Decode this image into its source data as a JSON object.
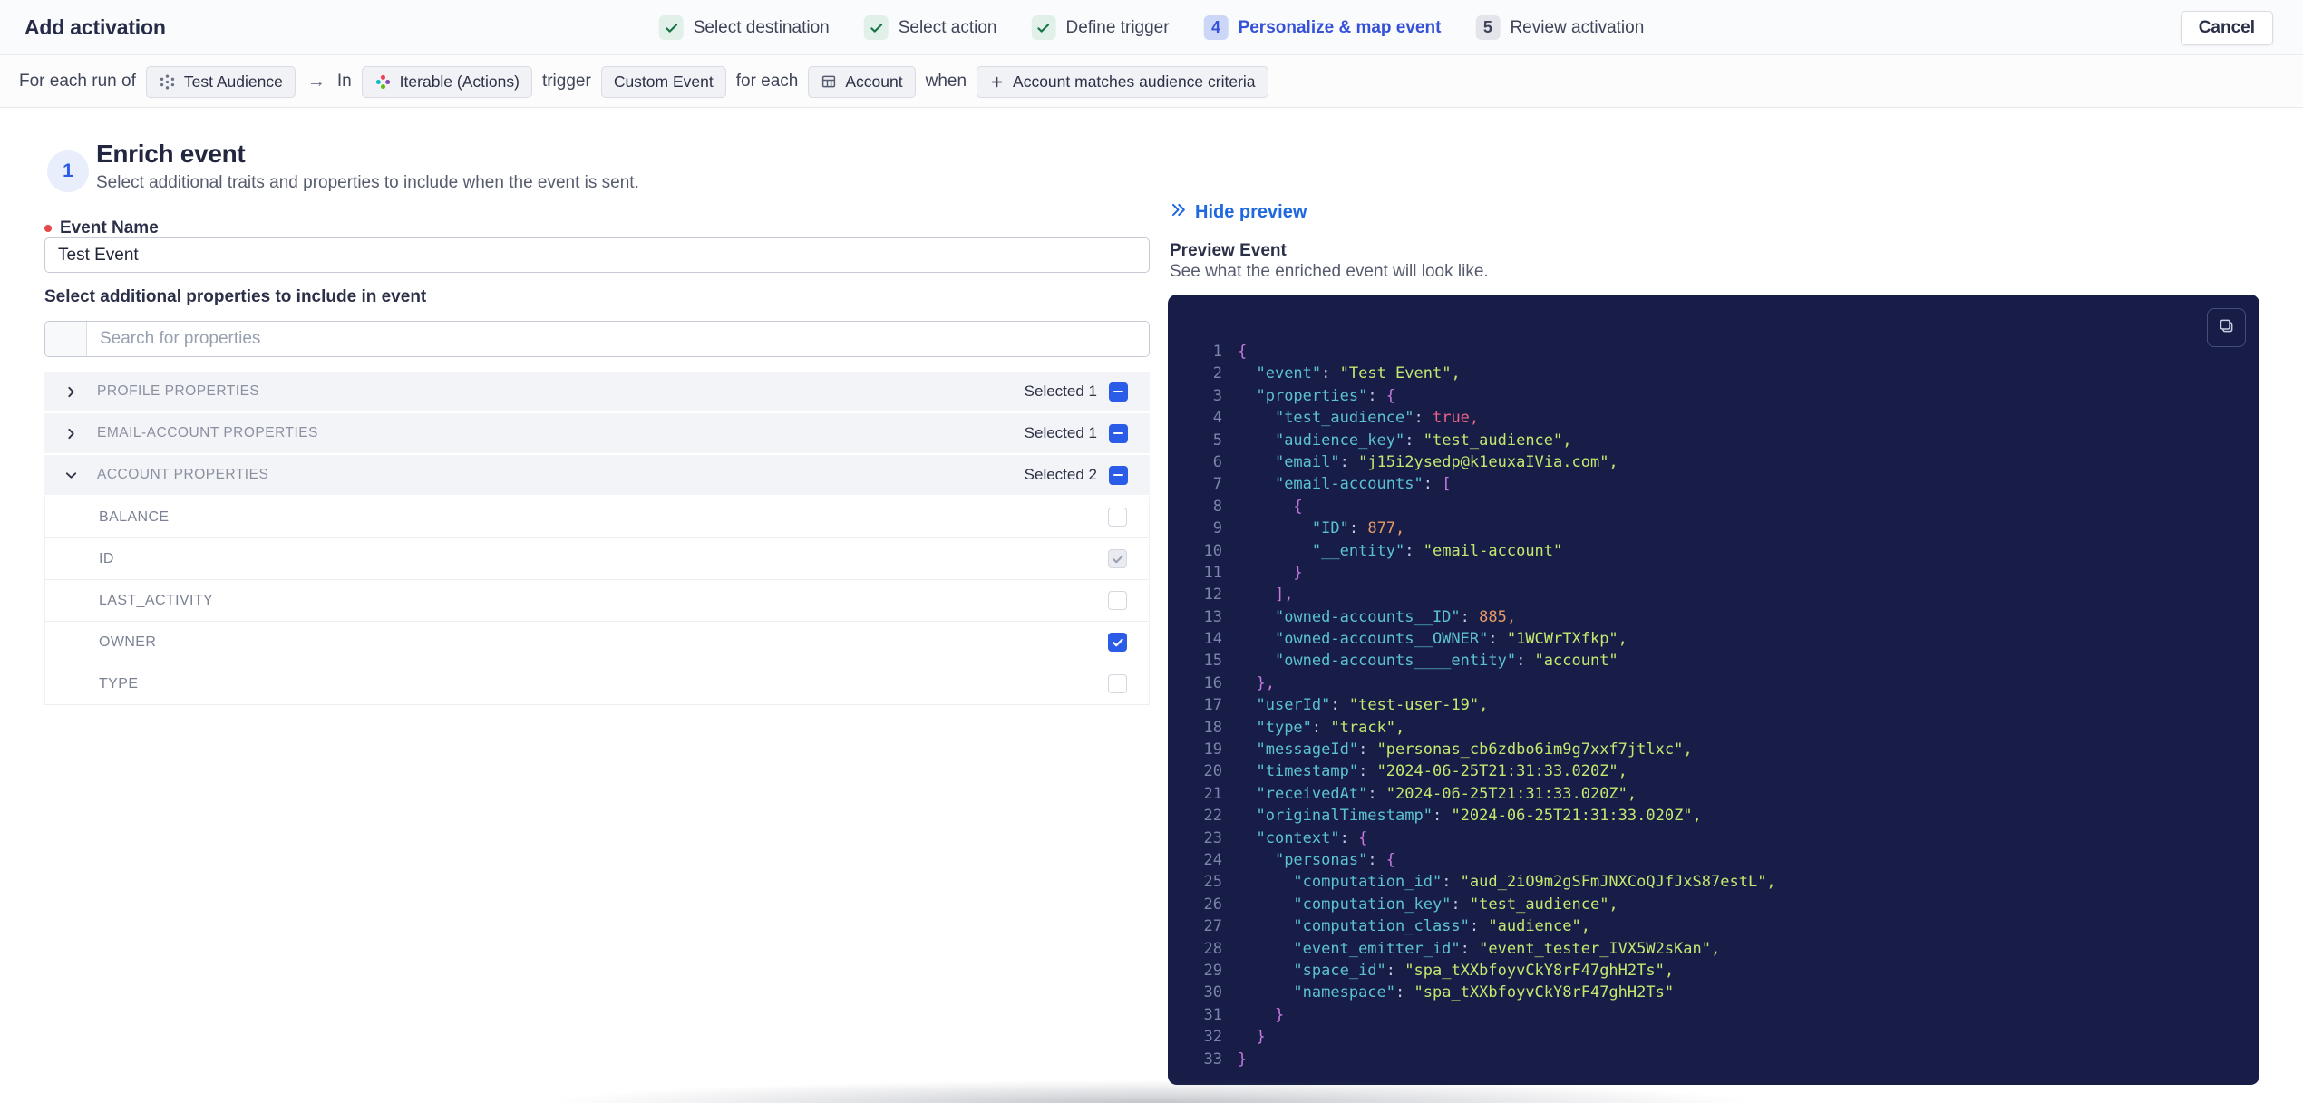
{
  "header": {
    "title": "Add activation",
    "cancel_label": "Cancel",
    "steps": [
      {
        "label": "Select destination",
        "state": "done"
      },
      {
        "label": "Select action",
        "state": "done"
      },
      {
        "label": "Define trigger",
        "state": "done"
      },
      {
        "label": "Personalize & map event",
        "state": "active",
        "number": "4"
      },
      {
        "label": "Review activation",
        "state": "upcoming",
        "number": "5"
      }
    ]
  },
  "trigger_bar": {
    "segments": [
      {
        "type": "text",
        "text": "For each run of"
      },
      {
        "type": "chip",
        "icon": "audience-icon",
        "text": "Test Audience"
      },
      {
        "type": "arrow",
        "text": "→"
      },
      {
        "type": "text",
        "text": "In"
      },
      {
        "type": "chip",
        "icon": "iterable-icon",
        "text": "Iterable (Actions)"
      },
      {
        "type": "text",
        "text": "trigger"
      },
      {
        "type": "chip",
        "icon": null,
        "text": "Custom Event"
      },
      {
        "type": "text",
        "text": "for each"
      },
      {
        "type": "chip",
        "icon": "table-icon",
        "text": "Account"
      },
      {
        "type": "text",
        "text": "when"
      },
      {
        "type": "chip",
        "icon": "plus-icon",
        "text": "Account matches audience criteria"
      }
    ]
  },
  "enrich": {
    "step_number": "1",
    "title": "Enrich event",
    "subtitle": "Select additional traits and properties to include when the event is sent.",
    "event_name_label": "Event Name",
    "event_name_value": "Test Event",
    "properties_label": "Select additional properties to include in event",
    "search_placeholder": "Search for properties",
    "groups": [
      {
        "label": "PROFILE PROPERTIES",
        "selected": "Selected 1",
        "expanded": false,
        "items": []
      },
      {
        "label": "EMAIL-ACCOUNT PROPERTIES",
        "selected": "Selected 1",
        "expanded": false,
        "items": []
      },
      {
        "label": "ACCOUNT PROPERTIES",
        "selected": "Selected 2",
        "expanded": true,
        "items": [
          {
            "label": "BALANCE",
            "checkbox": "unchecked"
          },
          {
            "label": "ID",
            "checkbox": "checked-disabled"
          },
          {
            "label": "LAST_ACTIVITY",
            "checkbox": "unchecked"
          },
          {
            "label": "OWNER",
            "checkbox": "checked"
          },
          {
            "label": "TYPE",
            "checkbox": "unchecked"
          }
        ]
      }
    ]
  },
  "preview": {
    "hide_label": "Hide preview",
    "title": "Preview Event",
    "subtitle": "See what the enriched event will look like.",
    "copy_icon": "copy-icon",
    "code_lines": [
      {
        "tokens": [
          [
            "brace",
            "{"
          ]
        ]
      },
      {
        "tokens": [
          [
            "ws",
            "  "
          ],
          [
            "key",
            "\"event\""
          ],
          [
            "punct",
            ": "
          ],
          [
            "str",
            "\"Test Event\","
          ]
        ]
      },
      {
        "tokens": [
          [
            "ws",
            "  "
          ],
          [
            "key",
            "\"properties\""
          ],
          [
            "punct",
            ": "
          ],
          [
            "brace",
            "{"
          ]
        ]
      },
      {
        "tokens": [
          [
            "ws",
            "    "
          ],
          [
            "key",
            "\"test_audience\""
          ],
          [
            "punct",
            ": "
          ],
          [
            "bool",
            "true,"
          ]
        ]
      },
      {
        "tokens": [
          [
            "ws",
            "    "
          ],
          [
            "key",
            "\"audience_key\""
          ],
          [
            "punct",
            ": "
          ],
          [
            "str",
            "\"test_audience\","
          ]
        ]
      },
      {
        "tokens": [
          [
            "ws",
            "    "
          ],
          [
            "key",
            "\"email\""
          ],
          [
            "punct",
            ": "
          ],
          [
            "str",
            "\"j15i2ysedp@k1euxaIVia.com\","
          ]
        ]
      },
      {
        "tokens": [
          [
            "ws",
            "    "
          ],
          [
            "key",
            "\"email-accounts\""
          ],
          [
            "punct",
            ": "
          ],
          [
            "brace",
            "["
          ]
        ]
      },
      {
        "tokens": [
          [
            "ws",
            "      "
          ],
          [
            "brace",
            "{"
          ]
        ]
      },
      {
        "tokens": [
          [
            "ws",
            "        "
          ],
          [
            "key",
            "\"ID\""
          ],
          [
            "punct",
            ": "
          ],
          [
            "num",
            "877,"
          ]
        ]
      },
      {
        "tokens": [
          [
            "ws",
            "        "
          ],
          [
            "key",
            "\"__entity\""
          ],
          [
            "punct",
            ": "
          ],
          [
            "str",
            "\"email-account\""
          ]
        ]
      },
      {
        "tokens": [
          [
            "ws",
            "      "
          ],
          [
            "brace",
            "}"
          ]
        ]
      },
      {
        "tokens": [
          [
            "ws",
            "    "
          ],
          [
            "brace",
            "],"
          ]
        ]
      },
      {
        "tokens": [
          [
            "ws",
            "    "
          ],
          [
            "key",
            "\"owned-accounts__ID\""
          ],
          [
            "punct",
            ": "
          ],
          [
            "num",
            "885,"
          ]
        ]
      },
      {
        "tokens": [
          [
            "ws",
            "    "
          ],
          [
            "key",
            "\"owned-accounts__OWNER\""
          ],
          [
            "punct",
            ": "
          ],
          [
            "str",
            "\"1WCWrTXfkp\","
          ]
        ]
      },
      {
        "tokens": [
          [
            "ws",
            "    "
          ],
          [
            "key",
            "\"owned-accounts____entity\""
          ],
          [
            "punct",
            ": "
          ],
          [
            "str",
            "\"account\""
          ]
        ]
      },
      {
        "tokens": [
          [
            "ws",
            "  "
          ],
          [
            "brace",
            "},"
          ]
        ]
      },
      {
        "tokens": [
          [
            "ws",
            "  "
          ],
          [
            "key",
            "\"userId\""
          ],
          [
            "punct",
            ": "
          ],
          [
            "str",
            "\"test-user-19\","
          ]
        ]
      },
      {
        "tokens": [
          [
            "ws",
            "  "
          ],
          [
            "key",
            "\"type\""
          ],
          [
            "punct",
            ": "
          ],
          [
            "str",
            "\"track\","
          ]
        ]
      },
      {
        "tokens": [
          [
            "ws",
            "  "
          ],
          [
            "key",
            "\"messageId\""
          ],
          [
            "punct",
            ": "
          ],
          [
            "str",
            "\"personas_cb6zdbo6im9g7xxf7jtlxc\","
          ]
        ]
      },
      {
        "tokens": [
          [
            "ws",
            "  "
          ],
          [
            "key",
            "\"timestamp\""
          ],
          [
            "punct",
            ": "
          ],
          [
            "str",
            "\"2024-06-25T21:31:33.020Z\","
          ]
        ]
      },
      {
        "tokens": [
          [
            "ws",
            "  "
          ],
          [
            "key",
            "\"receivedAt\""
          ],
          [
            "punct",
            ": "
          ],
          [
            "str",
            "\"2024-06-25T21:31:33.020Z\","
          ]
        ]
      },
      {
        "tokens": [
          [
            "ws",
            "  "
          ],
          [
            "key",
            "\"originalTimestamp\""
          ],
          [
            "punct",
            ": "
          ],
          [
            "str",
            "\"2024-06-25T21:31:33.020Z\","
          ]
        ]
      },
      {
        "tokens": [
          [
            "ws",
            "  "
          ],
          [
            "key",
            "\"context\""
          ],
          [
            "punct",
            ": "
          ],
          [
            "brace",
            "{"
          ]
        ]
      },
      {
        "tokens": [
          [
            "ws",
            "    "
          ],
          [
            "key",
            "\"personas\""
          ],
          [
            "punct",
            ": "
          ],
          [
            "brace",
            "{"
          ]
        ]
      },
      {
        "tokens": [
          [
            "ws",
            "      "
          ],
          [
            "key",
            "\"computation_id\""
          ],
          [
            "punct",
            ": "
          ],
          [
            "str",
            "\"aud_2iO9m2gSFmJNXCoQJfJxS87estL\","
          ]
        ]
      },
      {
        "tokens": [
          [
            "ws",
            "      "
          ],
          [
            "key",
            "\"computation_key\""
          ],
          [
            "punct",
            ": "
          ],
          [
            "str",
            "\"test_audience\","
          ]
        ]
      },
      {
        "tokens": [
          [
            "ws",
            "      "
          ],
          [
            "key",
            "\"computation_class\""
          ],
          [
            "punct",
            ": "
          ],
          [
            "str",
            "\"audience\","
          ]
        ]
      },
      {
        "tokens": [
          [
            "ws",
            "      "
          ],
          [
            "key",
            "\"event_emitter_id\""
          ],
          [
            "punct",
            ": "
          ],
          [
            "str",
            "\"event_tester_IVX5W2sKan\","
          ]
        ]
      },
      {
        "tokens": [
          [
            "ws",
            "      "
          ],
          [
            "key",
            "\"space_id\""
          ],
          [
            "punct",
            ": "
          ],
          [
            "str",
            "\"spa_tXXbfoyvCkY8rF47ghH2Ts\","
          ]
        ]
      },
      {
        "tokens": [
          [
            "ws",
            "      "
          ],
          [
            "key",
            "\"namespace\""
          ],
          [
            "punct",
            ": "
          ],
          [
            "str",
            "\"spa_tXXbfoyvCkY8rF47ghH2Ts\""
          ]
        ]
      },
      {
        "tokens": [
          [
            "ws",
            "    "
          ],
          [
            "brace",
            "}"
          ]
        ]
      },
      {
        "tokens": [
          [
            "ws",
            "  "
          ],
          [
            "brace",
            "}"
          ]
        ]
      },
      {
        "tokens": [
          [
            "brace",
            "}"
          ]
        ]
      }
    ]
  },
  "colors": {
    "accent_blue": "#2a5ce8",
    "link_blue": "#2068df",
    "active_step_blue": "#3551d8",
    "success_green": "#177245",
    "danger_red": "#e5484d",
    "code_bg": "#171d47",
    "code_key": "#5cc3cd",
    "code_string": "#c6e76f",
    "code_number": "#e69a67",
    "code_boolean": "#ee6486",
    "code_brace": "#c678dd"
  }
}
